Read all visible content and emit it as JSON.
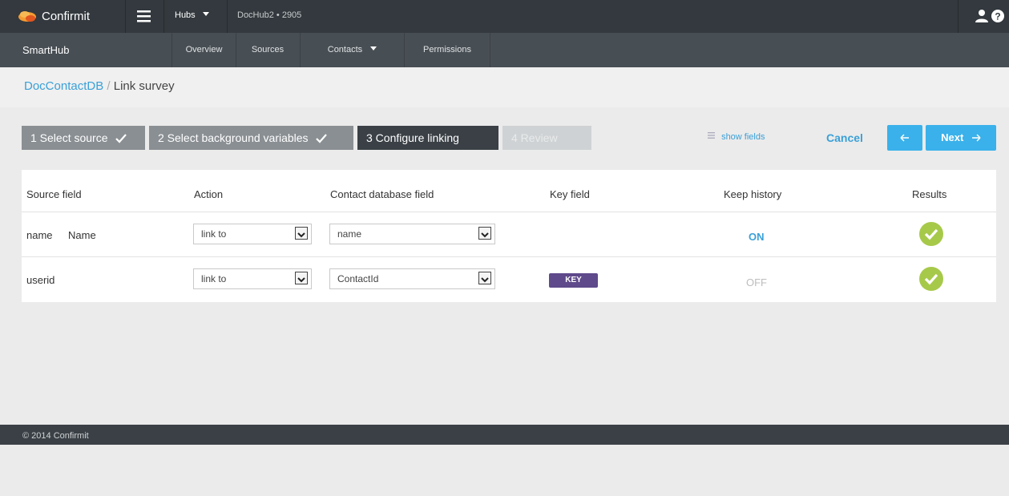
{
  "header": {
    "brand": "Confirmit",
    "hubs_label": "Hubs",
    "hub_path": "DocHub2 • 2905"
  },
  "subnav": {
    "app_name": "SmartHub",
    "tabs": [
      "Overview",
      "Sources",
      "Contacts",
      "Permissions"
    ]
  },
  "breadcrumb": {
    "parent": "DocContactDB",
    "separator": "/",
    "current": "Link survey"
  },
  "wizard": {
    "steps": [
      {
        "label": "1 Select source",
        "state": "done"
      },
      {
        "label": "2 Select background variables",
        "state": "done"
      },
      {
        "label": "3 Configure linking",
        "state": "active"
      },
      {
        "label": "4 Review",
        "state": "todo"
      }
    ],
    "show_fields": "show fields",
    "cancel": "Cancel",
    "next": "Next"
  },
  "table": {
    "columns": [
      "Source field",
      "Action",
      "Contact database field",
      "Key field",
      "Keep history",
      "Results"
    ],
    "rows": [
      {
        "source_field": "name",
        "source_label": "Name",
        "action": "link to",
        "contact_field": "name",
        "key": "",
        "keep_history": "ON",
        "result": "ok"
      },
      {
        "source_field": "userid",
        "source_label": "",
        "action": "link to",
        "contact_field": "ContactId",
        "key": "KEY",
        "keep_history": "OFF",
        "result": "ok"
      }
    ]
  },
  "footer": {
    "copyright": "© 2014 Confirmit"
  },
  "colors": {
    "accent": "#3ab1ea",
    "link": "#3aa0d8",
    "key_badge": "#5f4a8b",
    "success": "#a7c94a",
    "topbar": "#33393e",
    "subnav": "#474e54"
  }
}
